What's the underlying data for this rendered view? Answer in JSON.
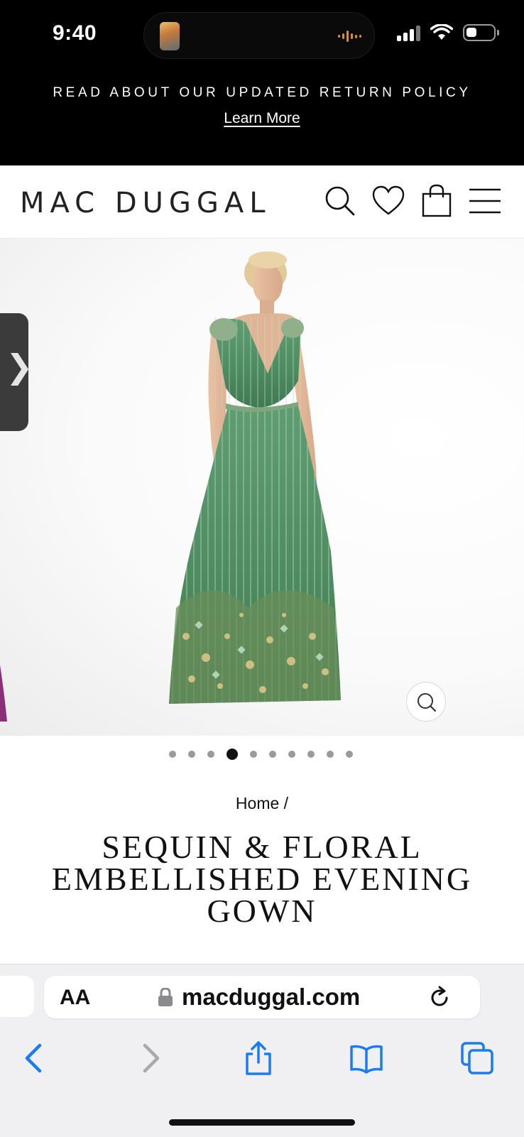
{
  "status_bar": {
    "time": "9:40",
    "icons": [
      "cellular-signal-icon",
      "wifi-icon",
      "battery-icon"
    ]
  },
  "announcement": {
    "text": "READ ABOUT OUR UPDATED RETURN POLICY",
    "link": "Learn More"
  },
  "header": {
    "logo": "MAC DUGGAL",
    "icons": [
      "search-icon",
      "heart-icon",
      "shopping-bag-icon",
      "menu-icon"
    ]
  },
  "gallery": {
    "image": "green sequin floral embellished evening gown",
    "side_tab_glyph": "❯",
    "slide_count": 10,
    "active_slide": 4
  },
  "breadcrumb": {
    "text": "Home /"
  },
  "product": {
    "title": "SEQUIN & FLORAL EMBELLISHED EVENING GOWN"
  },
  "browser": {
    "text_size_label": "AA",
    "url": "macduggal.com",
    "icons": [
      "back-icon",
      "forward-icon",
      "share-icon",
      "bookmarks-icon",
      "tabs-icon"
    ],
    "accent": "#1a7cf0"
  },
  "colors": {
    "banner_bg": "#000000",
    "page_bg": "#ffffff",
    "gown_green": "#4e8c62"
  }
}
